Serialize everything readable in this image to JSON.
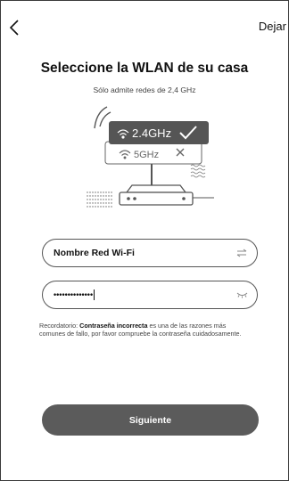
{
  "header": {
    "back_label": "<",
    "skip_label": "Dejar"
  },
  "main": {
    "title": "Seleccione la WLAN de su casa",
    "subtitle": "Sólo admite redes de 2,4 GHz"
  },
  "illustration": {
    "band_supported_label": "2.4GHz",
    "band_unsupported_label": "5GHz",
    "supported_icon": "check-icon",
    "unsupported_icon": "x-icon"
  },
  "form": {
    "ssid_value": "Nombre Red Wi-Fi",
    "password_value": "••••••••••••••",
    "swap_icon": "swap-arrows-icon",
    "visibility_icon": "eye-closed-icon"
  },
  "reminder": {
    "prefix": "Recordatorio: ",
    "highlight": "Contraseña incorrecta",
    "suffix": " es una de las razones más comunes de fallo, por favor compruebe la contraseña cuidadosamente."
  },
  "footer": {
    "next_label": "Siguiente"
  },
  "colors": {
    "button_bg": "#5b5b5b",
    "text": "#111111",
    "muted": "#444444"
  }
}
